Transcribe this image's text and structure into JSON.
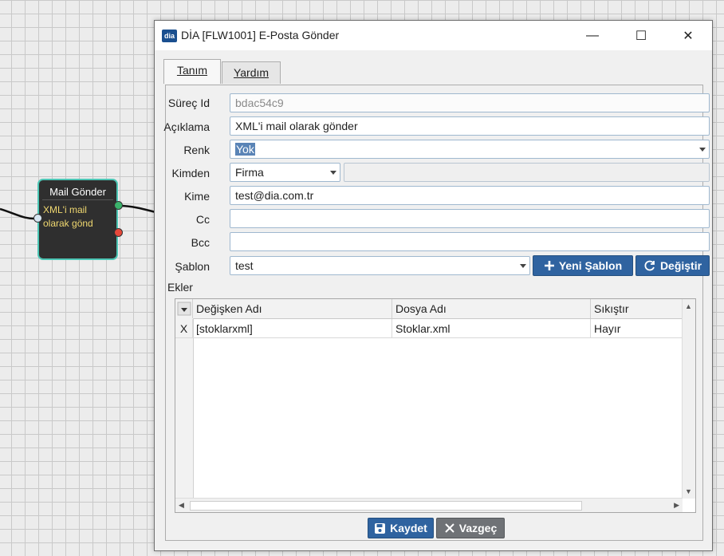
{
  "canvas": {
    "node": {
      "title": "Mail Gönder",
      "body_line1": "XML'i mail",
      "body_line2": "olarak gönd"
    }
  },
  "window": {
    "icon_text": "dia",
    "title": "DİA [FLW1001] E-Posta Gönder",
    "minimize_glyph": "—",
    "maximize_glyph": "☐",
    "close_glyph": "✕"
  },
  "tabs": [
    {
      "label": "Tanım",
      "active": true
    },
    {
      "label": "Yardım",
      "active": false
    }
  ],
  "form": {
    "surec_id": {
      "label": "Süreç Id",
      "value": "bdac54c9"
    },
    "aciklama": {
      "label": "Açıklama",
      "value": "XML'i mail olarak gönder"
    },
    "renk": {
      "label": "Renk",
      "value": "Yok"
    },
    "kimden": {
      "label": "Kimden",
      "value": "Firma",
      "extra_value": ""
    },
    "kime": {
      "label": "Kime",
      "value": "test@dia.com.tr"
    },
    "cc": {
      "label": "Cc",
      "value": ""
    },
    "bcc": {
      "label": "Bcc",
      "value": ""
    },
    "sablon": {
      "label": "Şablon",
      "value": "test"
    },
    "yeni_sablon_button": "Yeni Şablon",
    "degistir_button": "Değiştir"
  },
  "attachments": {
    "label": "Ekler",
    "columns": [
      "Değişken Adı",
      "Dosya Adı",
      "Sıkıştır"
    ],
    "rows": [
      {
        "marker": "X",
        "cells": [
          "[stoklarxml]",
          "Stoklar.xml",
          "Hayır"
        ]
      }
    ]
  },
  "footer": {
    "save_button": "Kaydet",
    "cancel_button": "Vazgeç"
  },
  "colors": {
    "primary_button": "#2f63a0",
    "secondary_button": "#6f7276",
    "node_border": "#4dc6b5",
    "selection": "#5a84b6"
  }
}
